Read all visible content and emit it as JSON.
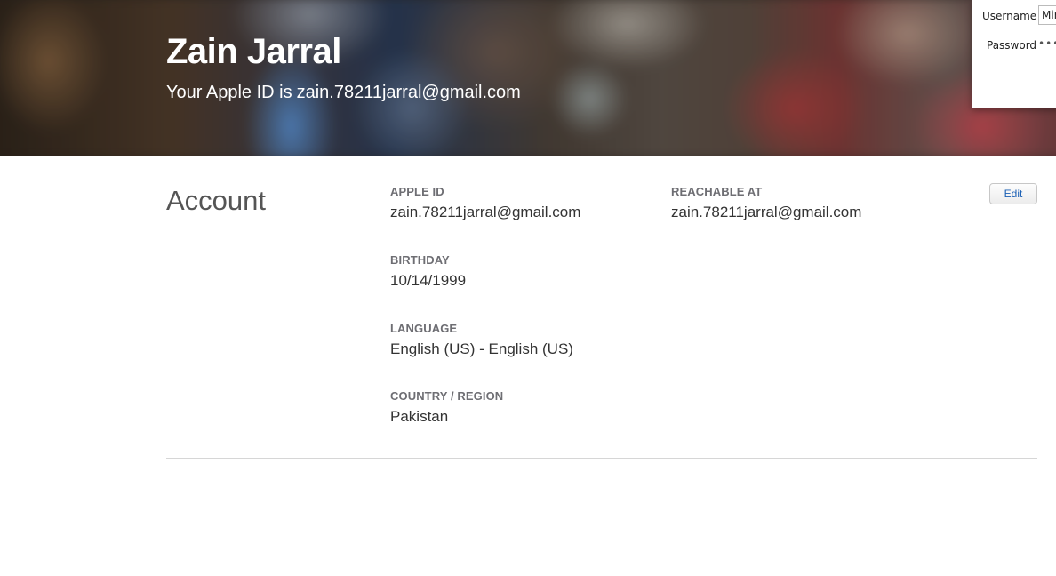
{
  "hero": {
    "name": "Zain Jarral",
    "subtitle_prefix": "Your Apple ID is",
    "subtitle_email": "zain.78211jarral@gmail.com"
  },
  "login_popup": {
    "username_label": "Username",
    "username_value": "Mir",
    "password_label": "Password",
    "password_value": "••••"
  },
  "account": {
    "title": "Account",
    "edit_label": "Edit",
    "fields": {
      "apple_id": {
        "label": "APPLE ID",
        "value": "zain.78211jarral@gmail.com"
      },
      "reachable_at": {
        "label": "REACHABLE AT",
        "value": "zain.78211jarral@gmail.com"
      },
      "birthday": {
        "label": "BIRTHDAY",
        "value": "10/14/1999"
      },
      "language": {
        "label": "LANGUAGE",
        "value": "English (US) - English (US)"
      },
      "country_region": {
        "label": "COUNTRY / REGION",
        "value": "Pakistan"
      }
    }
  },
  "colors": {
    "accent_link": "#1a5fb4",
    "label_gray": "#6e6e73",
    "divider": "#d6d6d6"
  }
}
